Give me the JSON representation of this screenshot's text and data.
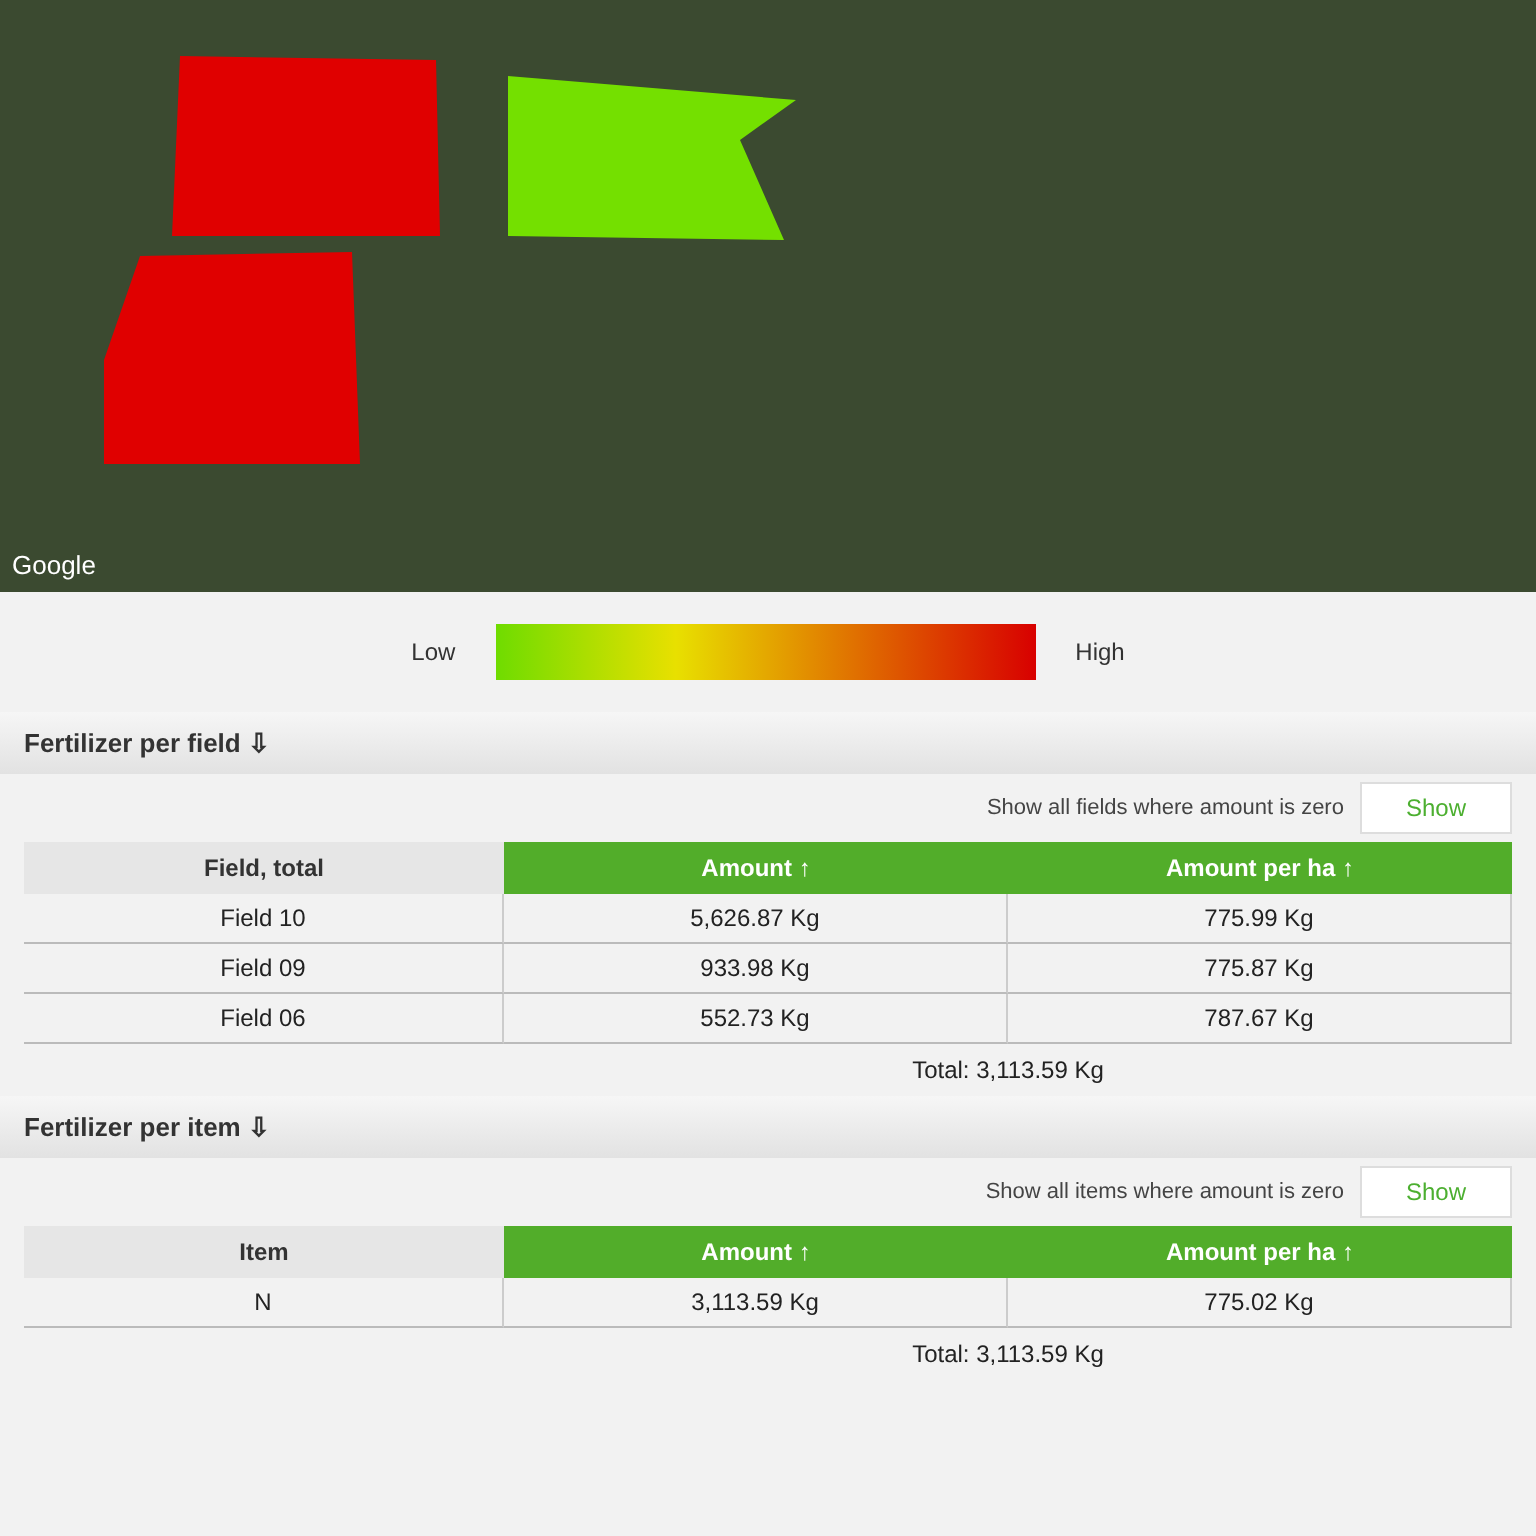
{
  "map": {
    "logo": "Google",
    "fields": [
      {
        "color": "#e00000"
      },
      {
        "color": "#74e000"
      },
      {
        "color": "#e00000"
      }
    ]
  },
  "legend": {
    "low": "Low",
    "high": "High"
  },
  "sections": [
    {
      "title": "Fertilizer per field ⇩",
      "filter_label": "Show all fields where amount is zero",
      "filter_button": "Show",
      "columns": [
        "Field, total",
        "Amount ↑",
        "Amount per ha ↑"
      ],
      "rows": [
        [
          "Field 10",
          "5,626.87 Kg",
          "775.99 Kg"
        ],
        [
          "Field 09",
          "933.98 Kg",
          "775.87 Kg"
        ],
        [
          "Field 06",
          "552.73 Kg",
          "787.67 Kg"
        ]
      ],
      "total": "Total: 3,113.59 Kg"
    },
    {
      "title": "Fertilizer per item ⇩",
      "filter_label": "Show all items where amount is zero",
      "filter_button": "Show",
      "columns": [
        "Item",
        "Amount ↑",
        "Amount per ha ↑"
      ],
      "rows": [
        [
          "N",
          "3,113.59 Kg",
          "775.02 Kg"
        ]
      ],
      "total": "Total: 3,113.59 Kg"
    }
  ]
}
